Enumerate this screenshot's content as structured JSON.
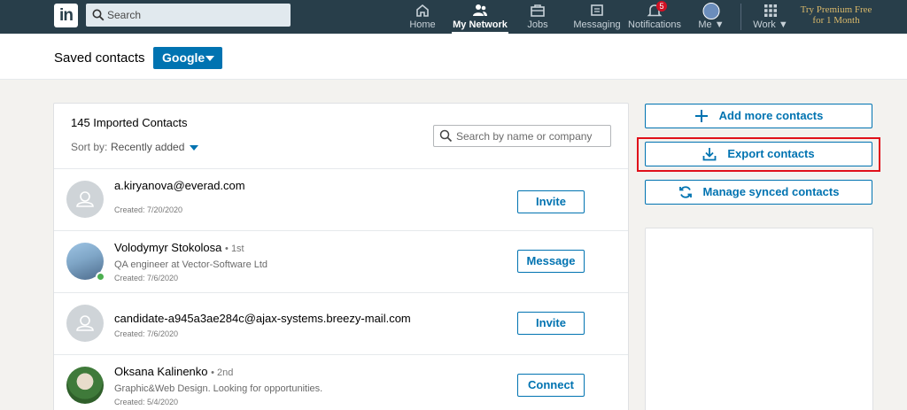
{
  "nav": {
    "logo": "in",
    "search_placeholder": "Search",
    "items": [
      {
        "label": "Home",
        "icon": "home-icon"
      },
      {
        "label": "My Network",
        "icon": "network-icon",
        "active": true
      },
      {
        "label": "Jobs",
        "icon": "briefcase-icon"
      },
      {
        "label": "Messaging",
        "icon": "messaging-icon"
      },
      {
        "label": "Notifications",
        "icon": "bell-icon",
        "badge": "5"
      },
      {
        "label": "Me",
        "icon": "avatar"
      },
      {
        "label": "Work",
        "icon": "grid-icon"
      }
    ],
    "premium_line1": "Try Premium Free",
    "premium_line2": "for 1 Month"
  },
  "header": {
    "title": "Saved contacts",
    "source_button": "Google"
  },
  "contacts": {
    "count_label": "145 Imported Contacts",
    "sort_label": "Sort by:",
    "sort_value": "Recently added",
    "search_placeholder": "Search by name or company",
    "rows": [
      {
        "name": "a.kiryanova@everad.com",
        "degree": "",
        "headline": "",
        "created": "Created: 7/20/2020",
        "action": "Invite"
      },
      {
        "name": "Volodymyr Stokolosa",
        "degree": "• 1st",
        "headline": "QA engineer at Vector-Software Ltd",
        "created": "Created: 7/6/2020",
        "action": "Message"
      },
      {
        "name": "candidate-a945a3ae284c@ajax-systems.breezy-mail.com",
        "degree": "",
        "headline": "",
        "created": "Created: 7/6/2020",
        "action": "Invite"
      },
      {
        "name": "Oksana Kalinenko",
        "degree": "• 2nd",
        "headline": "Graphic&Web Design. Looking for opportunities.",
        "created": "Created: 5/4/2020",
        "action": "Connect"
      }
    ]
  },
  "sidebar": {
    "add_label": "Add more contacts",
    "export_label": "Export contacts",
    "manage_label": "Manage synced contacts"
  },
  "colors": {
    "nav_bg": "#283e4a",
    "accent": "#0073b1",
    "highlight": "#e0101a"
  }
}
